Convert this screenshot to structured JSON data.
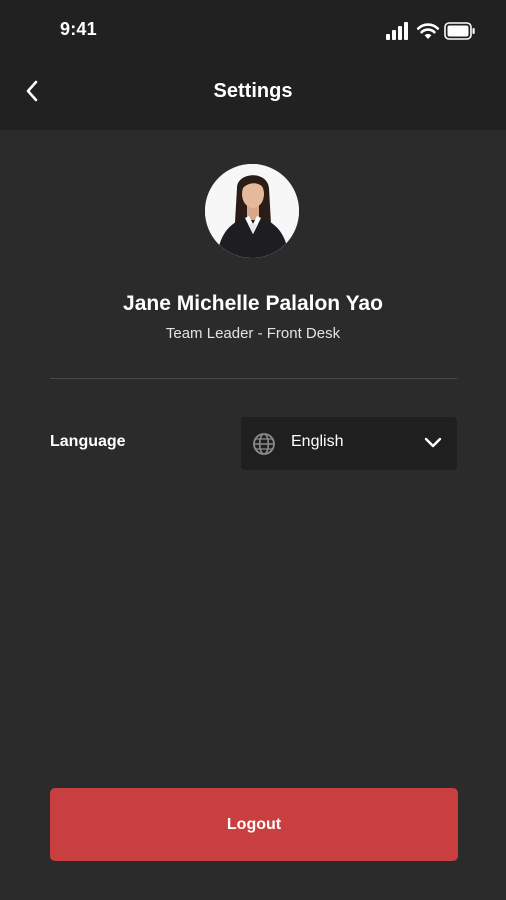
{
  "status_bar": {
    "time": "9:41",
    "icons": [
      "cellular-signal-icon",
      "wifi-icon",
      "battery-icon"
    ]
  },
  "header": {
    "title": "Settings",
    "back_icon": "chevron-left-icon"
  },
  "profile": {
    "name": "Jane Michelle Palalon Yao",
    "role": "Team Leader - Front Desk"
  },
  "language": {
    "label": "Language",
    "selected": "English",
    "icon": "globe-icon",
    "dropdown_icon": "chevron-down-icon"
  },
  "actions": {
    "logout_label": "Logout"
  },
  "colors": {
    "background": "#2b2b2b",
    "header": "#212121",
    "select_bg": "#1f1f1f",
    "logout": "#c93f3f"
  }
}
